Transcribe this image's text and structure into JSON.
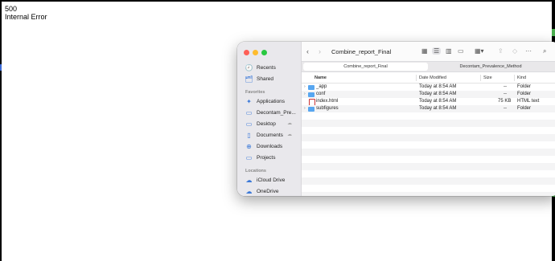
{
  "error": {
    "code": "500",
    "message": "Internal Error"
  },
  "finder": {
    "window_title": "Combine_report_Final",
    "tabs": [
      {
        "label": "Combine_report_Final",
        "active": true
      },
      {
        "label": "Decontam_Prevalence_Method",
        "active": false
      }
    ],
    "sidebar": {
      "top_items": [
        {
          "label": "Recents",
          "icon": "clock-icon"
        },
        {
          "label": "Shared",
          "icon": "shared-folder-icon"
        }
      ],
      "favorites_header": "Favorites",
      "favorites": [
        {
          "label": "Applications",
          "icon": "applications-icon"
        },
        {
          "label": "Decontam_Pre...",
          "icon": "folder-icon"
        },
        {
          "label": "Desktop",
          "icon": "desktop-icon"
        },
        {
          "label": "Documents",
          "icon": "document-icon"
        },
        {
          "label": "Downloads",
          "icon": "download-icon"
        },
        {
          "label": "Projects",
          "icon": "folder-icon"
        }
      ],
      "locations_header": "Locations",
      "locations": [
        {
          "label": "iCloud Drive",
          "icon": "cloud-icon"
        },
        {
          "label": "OneDrive",
          "icon": "cloud-icon"
        }
      ]
    },
    "columns": {
      "name": "Name",
      "date": "Date Modified",
      "size": "Size",
      "kind": "Kind"
    },
    "files": [
      {
        "name": "_app",
        "date": "Today at 8:54 AM",
        "size": "--",
        "kind": "Folder",
        "type": "folder",
        "expandable": true
      },
      {
        "name": "conf",
        "date": "Today at 8:54 AM",
        "size": "--",
        "kind": "Folder",
        "type": "folder",
        "expandable": true
      },
      {
        "name": "index.html",
        "date": "Today at 8:54 AM",
        "size": "75 KB",
        "kind": "HTML text",
        "type": "file",
        "expandable": false
      },
      {
        "name": "subfigures",
        "date": "Today at 8:54 AM",
        "size": "--",
        "kind": "Folder",
        "type": "folder",
        "expandable": true
      }
    ],
    "colors": {
      "folder": "#57a6f0",
      "close": "#fe5f57",
      "minimize": "#febc2e",
      "zoom": "#28c840"
    }
  }
}
